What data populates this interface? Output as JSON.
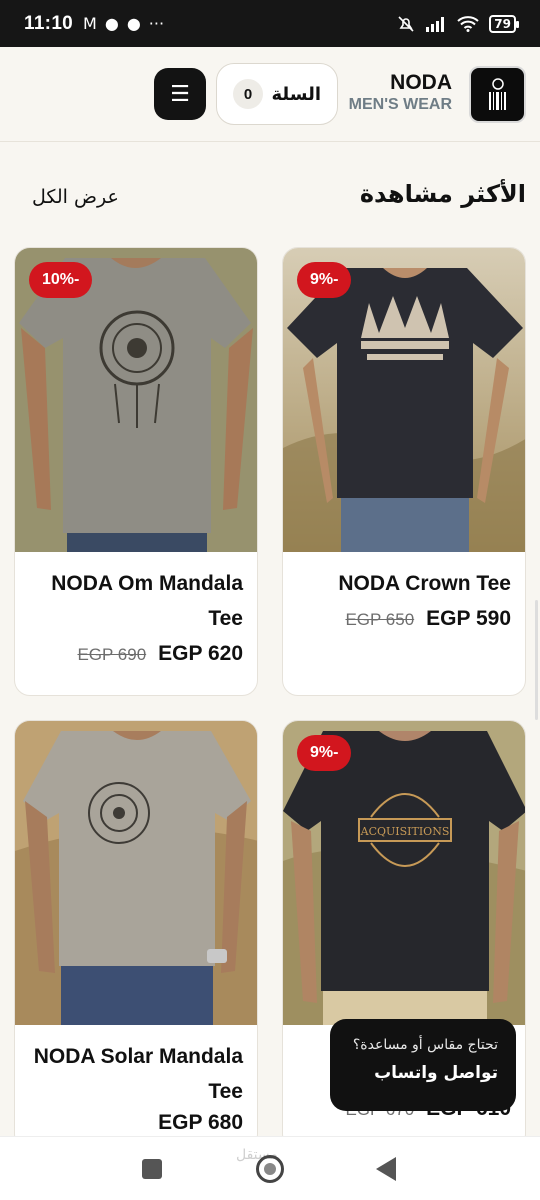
{
  "status_bar": {
    "time": "11:10",
    "battery": "79"
  },
  "header": {
    "cart_label": "السلة",
    "cart_count": "0",
    "brand_name": "NODA",
    "brand_sub": "MEN'S WEAR"
  },
  "section": {
    "title": "الأكثر مشاهدة",
    "view_all": "عرض الكل"
  },
  "products": [
    {
      "title": "NODA Crown Tee",
      "old_price": "EGP 650",
      "price": "EGP 590",
      "discount": "9%-"
    },
    {
      "title": "NODA Om Mandala Tee",
      "old_price": "EGP 690",
      "price": "EGP 620",
      "discount": "10%-"
    },
    {
      "title": "",
      "old_price": "EGP 670",
      "price": "EGP 610",
      "discount": "9%-"
    },
    {
      "title": "NODA Solar Mandala Tee",
      "old_price": "",
      "price": "EGP 680",
      "discount": ""
    }
  ],
  "help_widget": {
    "question": "تحتاج مقاس أو مساعدة؟",
    "action": "تواصل واتساب"
  },
  "watermark": "مستقل"
}
